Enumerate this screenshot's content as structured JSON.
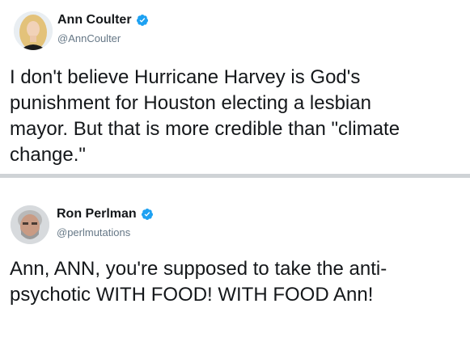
{
  "tweets": [
    {
      "display_name": "Ann Coulter",
      "handle": "@AnnCoulter",
      "verified_icon": "verified-badge-icon",
      "text_lines": [
        "I don't believe Hurricane Harvey is God's",
        "punishment for Houston electing a lesbian",
        "mayor. But that is more credible than \"climate",
        "change.\""
      ]
    },
    {
      "display_name": "Ron Perlman",
      "handle": "@perlmutations",
      "verified_icon": "verified-badge-icon",
      "text_lines": [
        "Ann, ANN, you're supposed to take the anti-",
        "psychotic WITH FOOD! WITH FOOD Ann!"
      ]
    }
  ],
  "colors": {
    "verified_blue": "#1da1f2",
    "handle_gray": "#657786",
    "divider_gray": "#cfd3d6",
    "text": "#14171a"
  }
}
